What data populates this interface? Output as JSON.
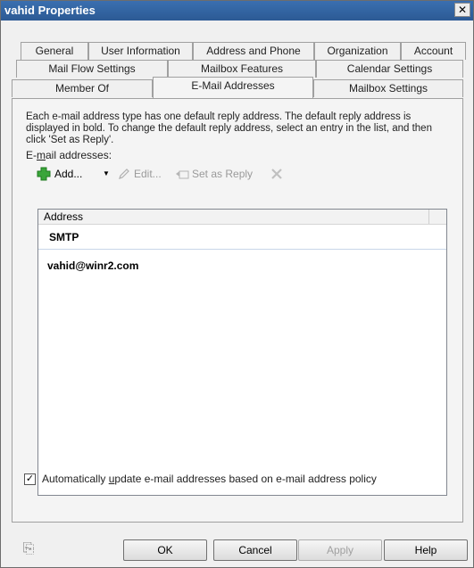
{
  "window": {
    "title": "vahid Properties",
    "close_glyph": "✕"
  },
  "tabs": {
    "row1": [
      "General",
      "User Information",
      "Address and Phone",
      "Organization",
      "Account"
    ],
    "row2": [
      "Mail Flow Settings",
      "Mailbox Features",
      "Calendar Settings"
    ],
    "row3": [
      "Member Of",
      "E-Mail Addresses",
      "Mailbox Settings"
    ],
    "active": "E-Mail Addresses"
  },
  "description": "Each e-mail address type has one default reply address. The default reply address is displayed in bold. To change the default reply address, select an entry in the list, and then click 'Set as Reply'.",
  "email_addresses_label": "E-mail addresses:",
  "toolbar": {
    "add": "Add...",
    "edit": "Edit...",
    "set_as_reply": "Set as Reply"
  },
  "list": {
    "column_header": "Address",
    "group": "SMTP",
    "items": [
      "vahid@winr2.com"
    ]
  },
  "auto_update": {
    "checked": true,
    "label": "Automatically update e-mail addresses based on e-mail address policy"
  },
  "buttons": {
    "ok": "OK",
    "cancel": "Cancel",
    "apply": "Apply",
    "help": "Help"
  },
  "colors": {
    "title_bar": "#2c5a94",
    "add_icon": "#3aa53a",
    "delete_icon": "#c0c0c0"
  }
}
